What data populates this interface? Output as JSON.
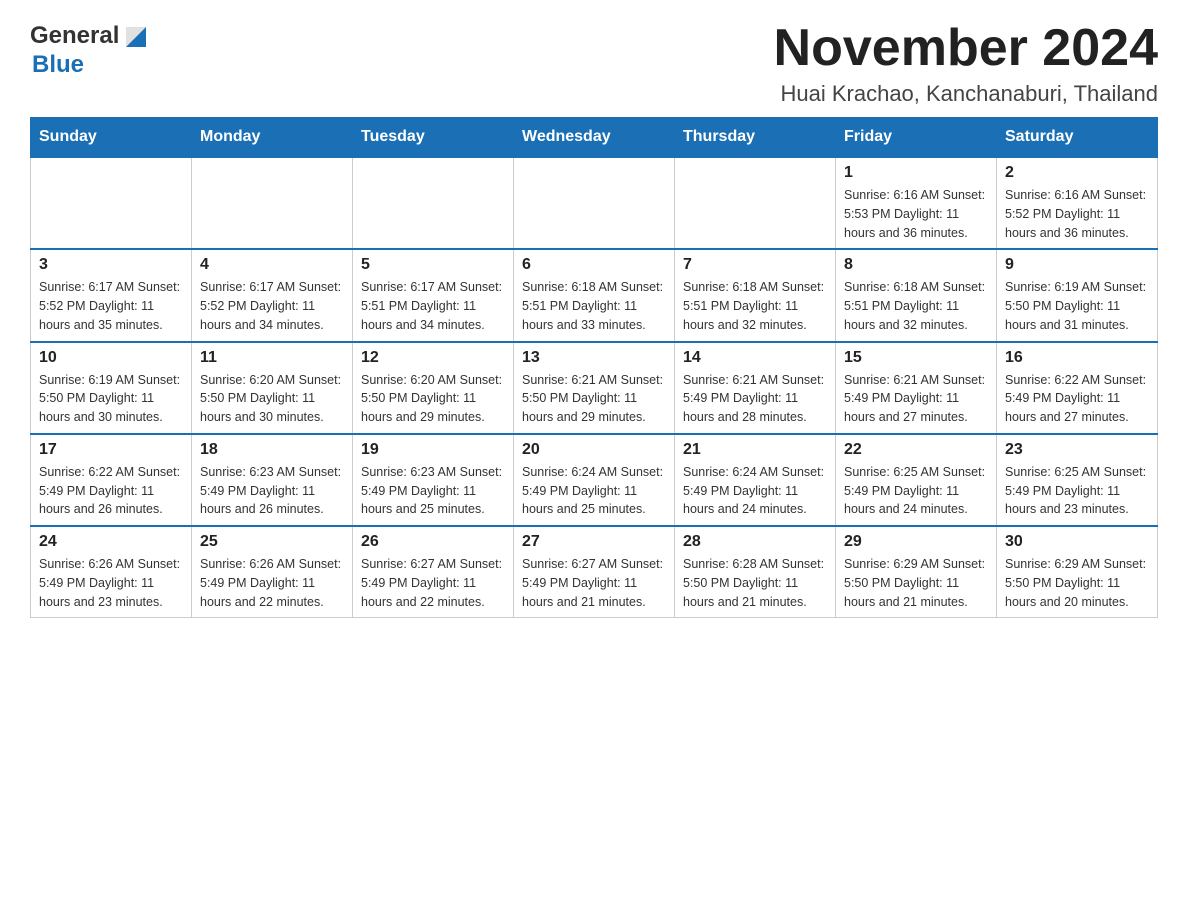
{
  "header": {
    "logo": {
      "general": "General",
      "blue": "Blue",
      "triangle_color": "#1a6fb5"
    },
    "title": "November 2024",
    "subtitle": "Huai Krachao, Kanchanaburi, Thailand"
  },
  "calendar": {
    "days_of_week": [
      "Sunday",
      "Monday",
      "Tuesday",
      "Wednesday",
      "Thursday",
      "Friday",
      "Saturday"
    ],
    "weeks": [
      [
        {
          "day": "",
          "info": ""
        },
        {
          "day": "",
          "info": ""
        },
        {
          "day": "",
          "info": ""
        },
        {
          "day": "",
          "info": ""
        },
        {
          "day": "",
          "info": ""
        },
        {
          "day": "1",
          "info": "Sunrise: 6:16 AM\nSunset: 5:53 PM\nDaylight: 11 hours and 36 minutes."
        },
        {
          "day": "2",
          "info": "Sunrise: 6:16 AM\nSunset: 5:52 PM\nDaylight: 11 hours and 36 minutes."
        }
      ],
      [
        {
          "day": "3",
          "info": "Sunrise: 6:17 AM\nSunset: 5:52 PM\nDaylight: 11 hours and 35 minutes."
        },
        {
          "day": "4",
          "info": "Sunrise: 6:17 AM\nSunset: 5:52 PM\nDaylight: 11 hours and 34 minutes."
        },
        {
          "day": "5",
          "info": "Sunrise: 6:17 AM\nSunset: 5:51 PM\nDaylight: 11 hours and 34 minutes."
        },
        {
          "day": "6",
          "info": "Sunrise: 6:18 AM\nSunset: 5:51 PM\nDaylight: 11 hours and 33 minutes."
        },
        {
          "day": "7",
          "info": "Sunrise: 6:18 AM\nSunset: 5:51 PM\nDaylight: 11 hours and 32 minutes."
        },
        {
          "day": "8",
          "info": "Sunrise: 6:18 AM\nSunset: 5:51 PM\nDaylight: 11 hours and 32 minutes."
        },
        {
          "day": "9",
          "info": "Sunrise: 6:19 AM\nSunset: 5:50 PM\nDaylight: 11 hours and 31 minutes."
        }
      ],
      [
        {
          "day": "10",
          "info": "Sunrise: 6:19 AM\nSunset: 5:50 PM\nDaylight: 11 hours and 30 minutes."
        },
        {
          "day": "11",
          "info": "Sunrise: 6:20 AM\nSunset: 5:50 PM\nDaylight: 11 hours and 30 minutes."
        },
        {
          "day": "12",
          "info": "Sunrise: 6:20 AM\nSunset: 5:50 PM\nDaylight: 11 hours and 29 minutes."
        },
        {
          "day": "13",
          "info": "Sunrise: 6:21 AM\nSunset: 5:50 PM\nDaylight: 11 hours and 29 minutes."
        },
        {
          "day": "14",
          "info": "Sunrise: 6:21 AM\nSunset: 5:49 PM\nDaylight: 11 hours and 28 minutes."
        },
        {
          "day": "15",
          "info": "Sunrise: 6:21 AM\nSunset: 5:49 PM\nDaylight: 11 hours and 27 minutes."
        },
        {
          "day": "16",
          "info": "Sunrise: 6:22 AM\nSunset: 5:49 PM\nDaylight: 11 hours and 27 minutes."
        }
      ],
      [
        {
          "day": "17",
          "info": "Sunrise: 6:22 AM\nSunset: 5:49 PM\nDaylight: 11 hours and 26 minutes."
        },
        {
          "day": "18",
          "info": "Sunrise: 6:23 AM\nSunset: 5:49 PM\nDaylight: 11 hours and 26 minutes."
        },
        {
          "day": "19",
          "info": "Sunrise: 6:23 AM\nSunset: 5:49 PM\nDaylight: 11 hours and 25 minutes."
        },
        {
          "day": "20",
          "info": "Sunrise: 6:24 AM\nSunset: 5:49 PM\nDaylight: 11 hours and 25 minutes."
        },
        {
          "day": "21",
          "info": "Sunrise: 6:24 AM\nSunset: 5:49 PM\nDaylight: 11 hours and 24 minutes."
        },
        {
          "day": "22",
          "info": "Sunrise: 6:25 AM\nSunset: 5:49 PM\nDaylight: 11 hours and 24 minutes."
        },
        {
          "day": "23",
          "info": "Sunrise: 6:25 AM\nSunset: 5:49 PM\nDaylight: 11 hours and 23 minutes."
        }
      ],
      [
        {
          "day": "24",
          "info": "Sunrise: 6:26 AM\nSunset: 5:49 PM\nDaylight: 11 hours and 23 minutes."
        },
        {
          "day": "25",
          "info": "Sunrise: 6:26 AM\nSunset: 5:49 PM\nDaylight: 11 hours and 22 minutes."
        },
        {
          "day": "26",
          "info": "Sunrise: 6:27 AM\nSunset: 5:49 PM\nDaylight: 11 hours and 22 minutes."
        },
        {
          "day": "27",
          "info": "Sunrise: 6:27 AM\nSunset: 5:49 PM\nDaylight: 11 hours and 21 minutes."
        },
        {
          "day": "28",
          "info": "Sunrise: 6:28 AM\nSunset: 5:50 PM\nDaylight: 11 hours and 21 minutes."
        },
        {
          "day": "29",
          "info": "Sunrise: 6:29 AM\nSunset: 5:50 PM\nDaylight: 11 hours and 21 minutes."
        },
        {
          "day": "30",
          "info": "Sunrise: 6:29 AM\nSunset: 5:50 PM\nDaylight: 11 hours and 20 minutes."
        }
      ]
    ]
  }
}
